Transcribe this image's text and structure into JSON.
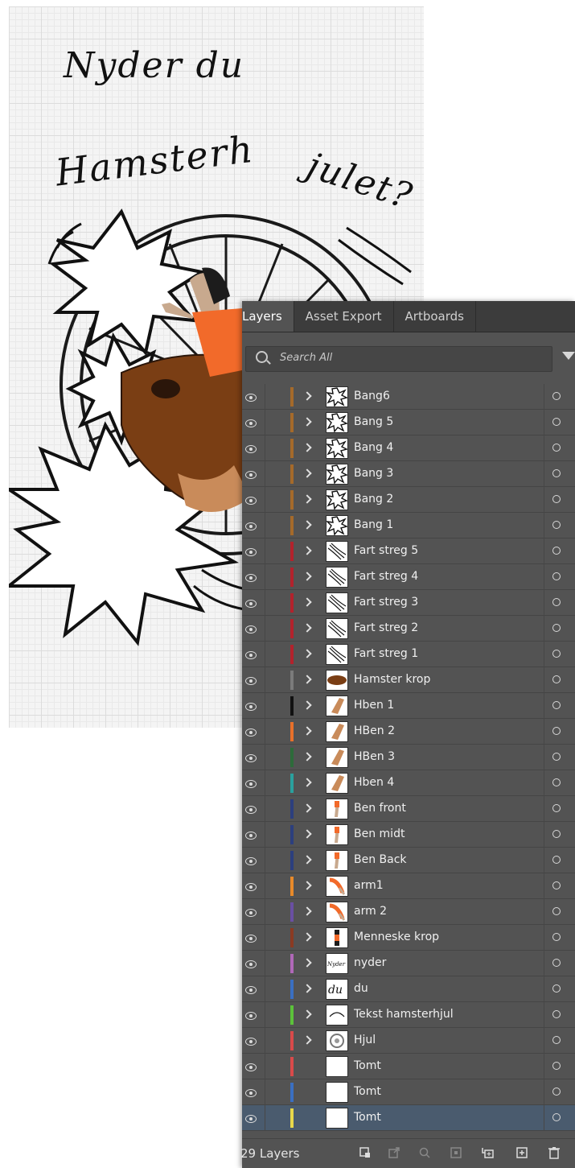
{
  "artwork": {
    "line1": "Nyder du",
    "line2a": "Hamsterh",
    "line2b": "julet?"
  },
  "panel": {
    "tabs": [
      {
        "label": "Layers",
        "active": true
      },
      {
        "label": "Asset Export",
        "active": false
      },
      {
        "label": "Artboards",
        "active": false
      }
    ],
    "search_placeholder": "Search All",
    "layer_count": "29 Layers"
  },
  "layers": [
    {
      "name": "Bang6",
      "color": "#a56a2a",
      "thumb": "bang-burst"
    },
    {
      "name": "Bang 5",
      "color": "#a56a2a",
      "thumb": "bang-burst"
    },
    {
      "name": "Bang 4",
      "color": "#a56a2a",
      "thumb": "bang-burst"
    },
    {
      "name": "Bang 3",
      "color": "#a56a2a",
      "thumb": "bang-burst"
    },
    {
      "name": "Bang 2",
      "color": "#a56a2a",
      "thumb": "bang-burst"
    },
    {
      "name": "Bang 1",
      "color": "#a56a2a",
      "thumb": "bang-burst"
    },
    {
      "name": "Fart streg 5",
      "color": "#b3222c",
      "thumb": "speed-lines"
    },
    {
      "name": "Fart streg 4",
      "color": "#b3222c",
      "thumb": "speed-lines"
    },
    {
      "name": "Fart streg 3",
      "color": "#b3222c",
      "thumb": "speed-lines"
    },
    {
      "name": "Fart streg 2",
      "color": "#b3222c",
      "thumb": "speed-lines"
    },
    {
      "name": "Fart streg 1",
      "color": "#b3222c",
      "thumb": "speed-lines"
    },
    {
      "name": "Hamster krop",
      "color": "#7b7b7b",
      "thumb": "hamster-body"
    },
    {
      "name": "Hben 1",
      "color": "#111111",
      "thumb": "hamster-leg"
    },
    {
      "name": "HBen 2",
      "color": "#e8702a",
      "thumb": "hamster-leg"
    },
    {
      "name": "HBen 3",
      "color": "#2d6b3a",
      "thumb": "hamster-leg"
    },
    {
      "name": "Hben 4",
      "color": "#2aa19e",
      "thumb": "hamster-leg"
    },
    {
      "name": "Ben front",
      "color": "#2c3f7e",
      "thumb": "human-leg"
    },
    {
      "name": "Ben midt",
      "color": "#2c3f7e",
      "thumb": "human-leg"
    },
    {
      "name": "Ben Back",
      "color": "#2c3f7e",
      "thumb": "human-leg"
    },
    {
      "name": "arm1",
      "color": "#e88a2a",
      "thumb": "arm"
    },
    {
      "name": "arm 2",
      "color": "#6a4fa3",
      "thumb": "arm"
    },
    {
      "name": "Menneske krop",
      "color": "#8b3a22",
      "thumb": "human-body"
    },
    {
      "name": "nyder",
      "color": "#b068b8",
      "thumb": "text-nyder"
    },
    {
      "name": "du",
      "color": "#3a6fc2",
      "thumb": "text-du"
    },
    {
      "name": "Tekst hamsterhjul",
      "color": "#5cc23a",
      "thumb": "text-arc"
    },
    {
      "name": "Hjul",
      "color": "#d94a4a",
      "thumb": "wheel"
    },
    {
      "name": "Tomt",
      "color": "#d94a4a",
      "thumb": "empty"
    },
    {
      "name": "Tomt",
      "color": "#3a6fc2",
      "thumb": "empty"
    },
    {
      "name": "Tomt",
      "color": "#e8d84a",
      "thumb": "empty"
    }
  ]
}
